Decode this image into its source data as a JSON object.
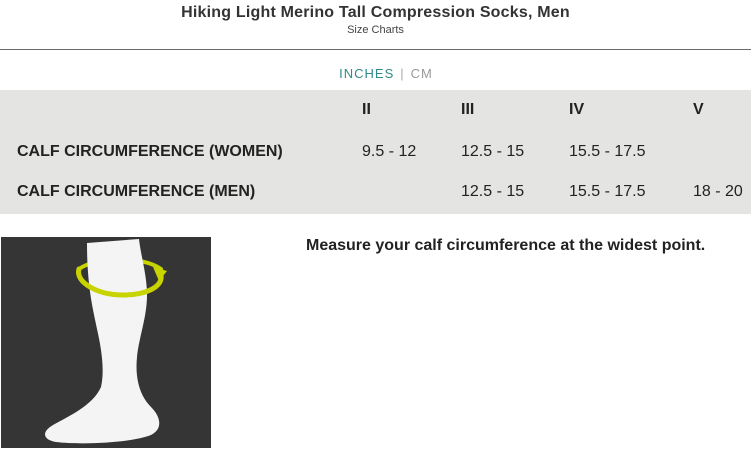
{
  "header": {
    "title": "Hiking Light Merino Tall Compression Socks, Men",
    "subtitle": "Size Charts"
  },
  "units": {
    "active": "INCHES",
    "separator": "|",
    "inactive": "CM"
  },
  "size_table": {
    "columns": [
      "II",
      "III",
      "IV",
      "V"
    ],
    "rows": [
      {
        "label": "CALF CIRCUMFERENCE (WOMEN)",
        "values": [
          "9.5 - 12",
          "12.5 - 15",
          "15.5 - 17.5",
          ""
        ]
      },
      {
        "label": "CALF CIRCUMFERENCE (MEN)",
        "values": [
          "",
          "12.5 - 15",
          "15.5 - 17.5",
          "18 - 20"
        ]
      }
    ]
  },
  "illustration": {
    "icon": "sock-calf-measure-icon",
    "accent_color": "#c8d400",
    "background_color": "#353535"
  },
  "instruction": "Measure your calf circumference at the widest point."
}
